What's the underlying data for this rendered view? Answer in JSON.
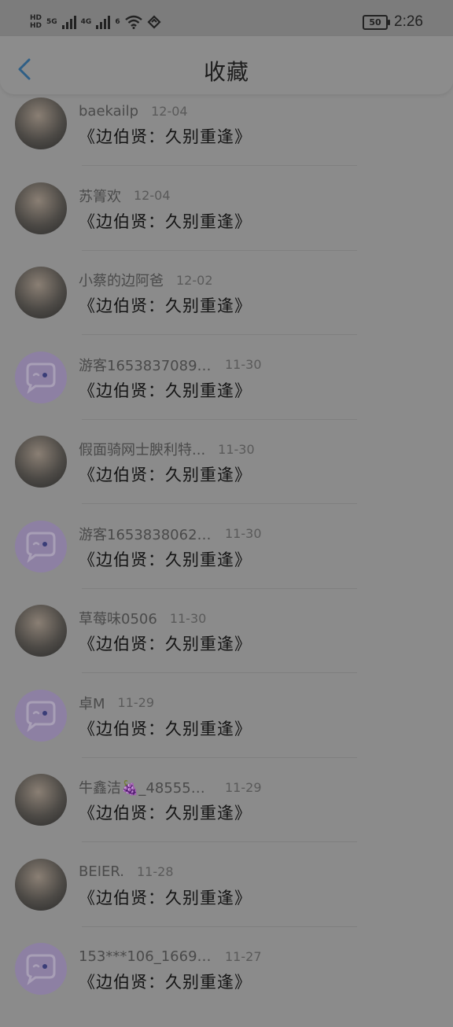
{
  "status_bar": {
    "left_labels": [
      "5G",
      "4G",
      "6"
    ],
    "battery": "50",
    "time": "2:26"
  },
  "header": {
    "title": "收藏"
  },
  "items": [
    {
      "user": "baekailp",
      "date": "12-04",
      "title": "《边伯贤：久别重逢》",
      "avatar": "photo"
    },
    {
      "user": "苏箐欢",
      "date": "12-04",
      "title": "《边伯贤：久别重逢》",
      "avatar": "photo"
    },
    {
      "user": "小蔡的边阿爸",
      "date": "12-02",
      "title": "《边伯贤：久别重逢》",
      "avatar": "photo"
    },
    {
      "user": "游客16538370898...",
      "date": "11-30",
      "title": "《边伯贤：久别重逢》",
      "avatar": "guest"
    },
    {
      "user": "假面骑网士腴利特...",
      "date": "11-30",
      "title": "《边伯贤：久别重逢》",
      "avatar": "photo"
    },
    {
      "user": "游客16538380625...",
      "date": "11-30",
      "title": "《边伯贤：久别重逢》",
      "avatar": "guest"
    },
    {
      "user": "草莓味0506",
      "date": "11-30",
      "title": "《边伯贤：久别重逢》",
      "avatar": "photo"
    },
    {
      "user": "卓M",
      "date": "11-29",
      "title": "《边伯贤：久别重逢》",
      "avatar": "guest"
    },
    {
      "user": "牛鑫洁🍇_485558...",
      "date": "11-29",
      "title": "《边伯贤：久别重逢》",
      "avatar": "photo"
    },
    {
      "user": "BEIER.",
      "date": "11-28",
      "title": "《边伯贤：久别重逢》",
      "avatar": "photo"
    },
    {
      "user": "153***106_16691...",
      "date": "11-27",
      "title": "《边伯贤：久别重逢》",
      "avatar": "guest"
    }
  ],
  "colors": {
    "overlay_bg": "#8b8b8b",
    "back_icon": "#2f5f86",
    "guest_avatar": "#8d80a3"
  }
}
